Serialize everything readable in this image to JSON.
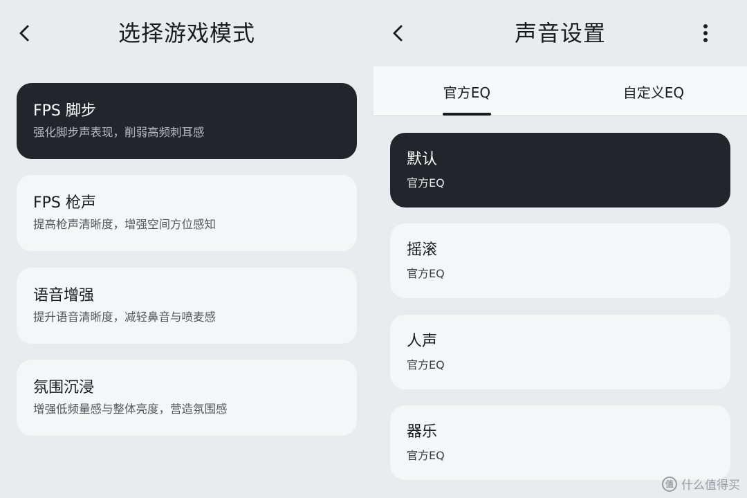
{
  "left_screen": {
    "title": "选择游戏模式",
    "modes": [
      {
        "title": "FPS 脚步",
        "subtitle": "强化脚步声表现，削弱高频刺耳感",
        "selected": true
      },
      {
        "title": "FPS 枪声",
        "subtitle": "提高枪声清晰度，增强空间方位感知",
        "selected": false
      },
      {
        "title": "语音增强",
        "subtitle": "提升语音清晰度，减轻鼻音与喷麦感",
        "selected": false
      },
      {
        "title": "氛围沉浸",
        "subtitle": "增强低频量感与整体亮度，营造氛围感",
        "selected": false
      }
    ]
  },
  "right_screen": {
    "title": "声音设置",
    "tabs": [
      {
        "label": "官方EQ",
        "active": true
      },
      {
        "label": "自定义EQ",
        "active": false
      }
    ],
    "presets": [
      {
        "title": "默认",
        "subtitle": "官方EQ",
        "selected": true
      },
      {
        "title": "摇滚",
        "subtitle": "官方EQ",
        "selected": false
      },
      {
        "title": "人声",
        "subtitle": "官方EQ",
        "selected": false
      },
      {
        "title": "器乐",
        "subtitle": "官方EQ",
        "selected": false
      }
    ]
  },
  "watermark": {
    "icon": "zhi",
    "text": "什么值得买"
  },
  "colors": {
    "background": "#e9ebef",
    "card": "#f5f6f8",
    "selected_card": "#24252a",
    "text": "#1a1b1f"
  }
}
